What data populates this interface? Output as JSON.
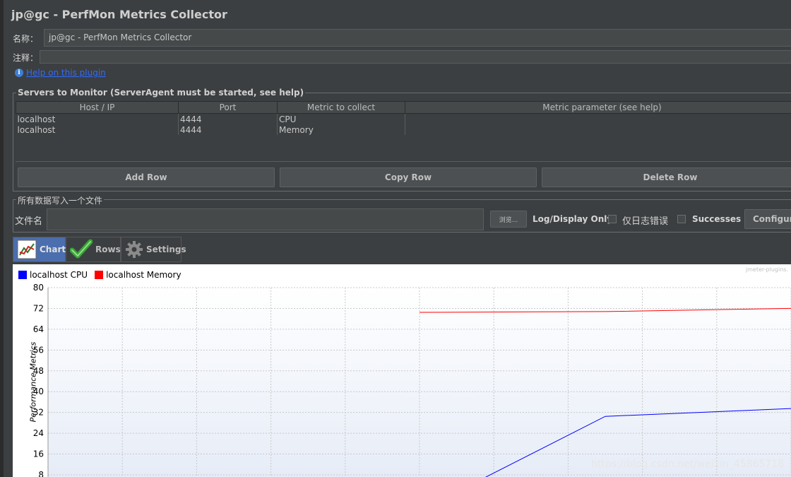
{
  "window": {
    "title": "jp@gc - PerfMon Metrics Collector"
  },
  "form": {
    "name_label": "名称：",
    "name_value": "jp@gc - PerfMon Metrics Collector",
    "comment_label": "注释：",
    "comment_value": "",
    "help_link": "Help on this plugin"
  },
  "servers": {
    "group_title": "Servers to Monitor (ServerAgent must be started, see help)",
    "columns": [
      "Host / IP",
      "Port",
      "Metric to collect",
      "Metric parameter (see help)"
    ],
    "rows": [
      [
        "localhost",
        "4444",
        "CPU",
        ""
      ],
      [
        "localhost",
        "4444",
        "Memory",
        ""
      ]
    ],
    "buttons": {
      "add": "Add Row",
      "copy": "Copy Row",
      "delete": "Delete Row"
    }
  },
  "file": {
    "group_title": "所有数据写入一个文件",
    "filename_label": "文件名",
    "filename_value": "",
    "browse_label": "浏览...",
    "log_display_label": "Log/Display Only:",
    "errors_only_label": "仅日志错误",
    "successes_label": "Successes",
    "configure_label": "Configure"
  },
  "tabs": [
    {
      "label": "Chart",
      "icon": "chart-icon",
      "active": true
    },
    {
      "label": "Rows",
      "icon": "checkmark-icon",
      "active": false
    },
    {
      "label": "Settings",
      "icon": "gear-icon",
      "active": false
    }
  ],
  "chart": {
    "watermark_top": "jmeter-plugins.",
    "watermark_bottom": "https://blog.csdn.net/weixin_45865718"
  },
  "chart_data": {
    "type": "line",
    "ylabel": "Performance Metrics",
    "ylim": [
      0,
      80
    ],
    "y_ticks": [
      8,
      16,
      24,
      32,
      40,
      48,
      56,
      64,
      72,
      80
    ],
    "grid": true,
    "legend_position": "top-left",
    "x_range": [
      0,
      10
    ],
    "series": [
      {
        "name": "localhost CPU",
        "color": "#0000ff",
        "points": [
          [
            5.4,
            0
          ],
          [
            7.5,
            30.5
          ],
          [
            10,
            33.5
          ]
        ]
      },
      {
        "name": "localhost Memory",
        "color": "#ff0000",
        "points": [
          [
            5,
            70.5
          ],
          [
            7.5,
            70.8
          ],
          [
            10,
            72.0
          ]
        ]
      }
    ]
  }
}
